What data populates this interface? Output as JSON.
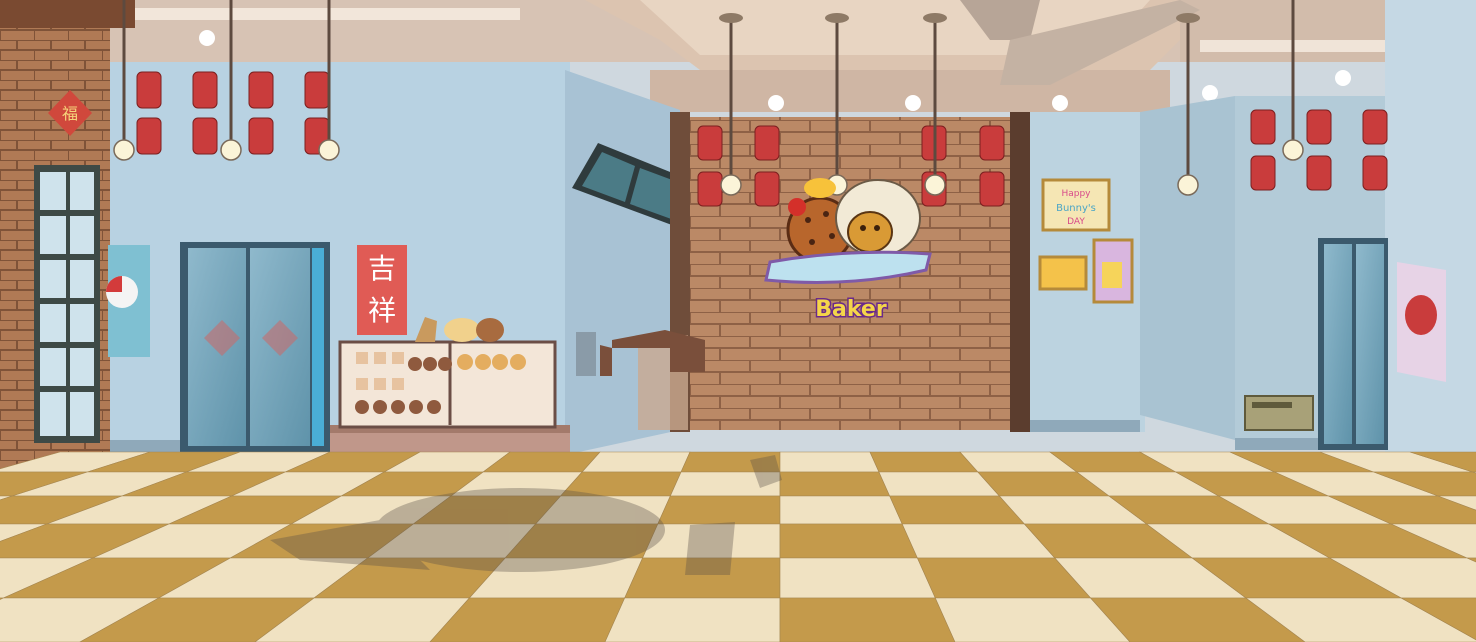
{
  "scene": {
    "baker_sign": "Baker",
    "red_banner": "吉祥",
    "poster_top_line1": "Happy",
    "poster_top_line2": "Bunny's",
    "poster_top_line3": "DAY"
  },
  "colors": {
    "wall": "#b9d3e3",
    "brick": "#b98764",
    "floor_light": "#f0e2c2",
    "floor_dark": "#c49a4b",
    "lantern": "#c33d3d",
    "sign_text": "#f4d54a"
  }
}
